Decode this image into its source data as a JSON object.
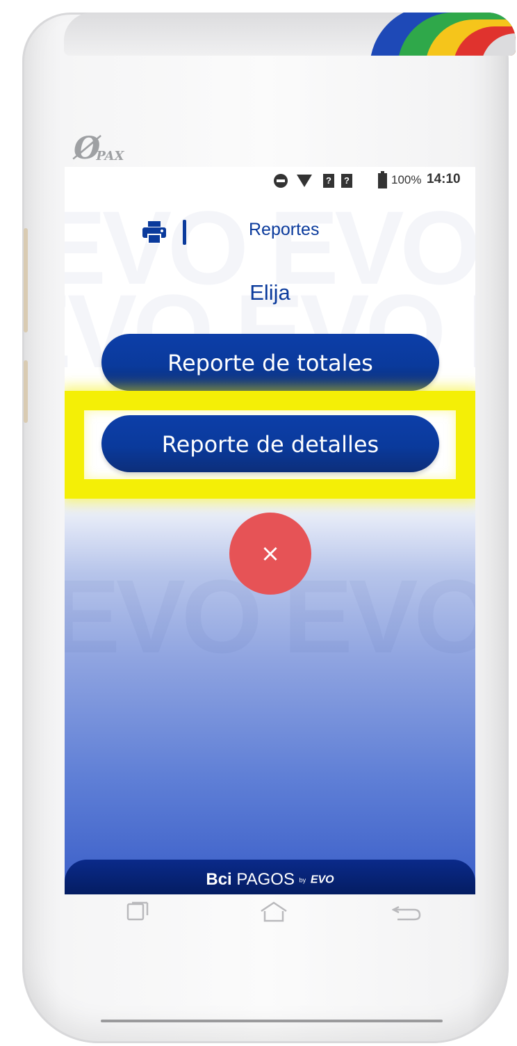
{
  "device": {
    "brand_logo": "PAX",
    "top_logo_text": "Bci PAGOS",
    "stripe_colors": [
      "#1e49b7",
      "#2fa84a",
      "#f5c51b",
      "#e0332e"
    ]
  },
  "status_bar": {
    "icons": [
      "do-not-disturb-icon",
      "wifi-icon",
      "sim-unknown-icon",
      "sim-unknown-icon",
      "battery-icon"
    ],
    "sim1_glyph": "?",
    "sim2_glyph": "?",
    "battery": "100%",
    "time": "14:10"
  },
  "header": {
    "icon": "printer-icon",
    "title": "Reportes"
  },
  "prompt": "Elija",
  "menu": [
    {
      "label": "Reporte de totales"
    },
    {
      "label": "Reporte de detalles",
      "highlighted": true
    }
  ],
  "close_button": {
    "label": "×",
    "color": "#e65356"
  },
  "footer": {
    "brand_bold": "Bci",
    "brand_light": "PAGOS",
    "by": "by",
    "partner": "EVO"
  },
  "colors": {
    "primary": "#0a3a9c",
    "highlight": "#f4ef06"
  }
}
